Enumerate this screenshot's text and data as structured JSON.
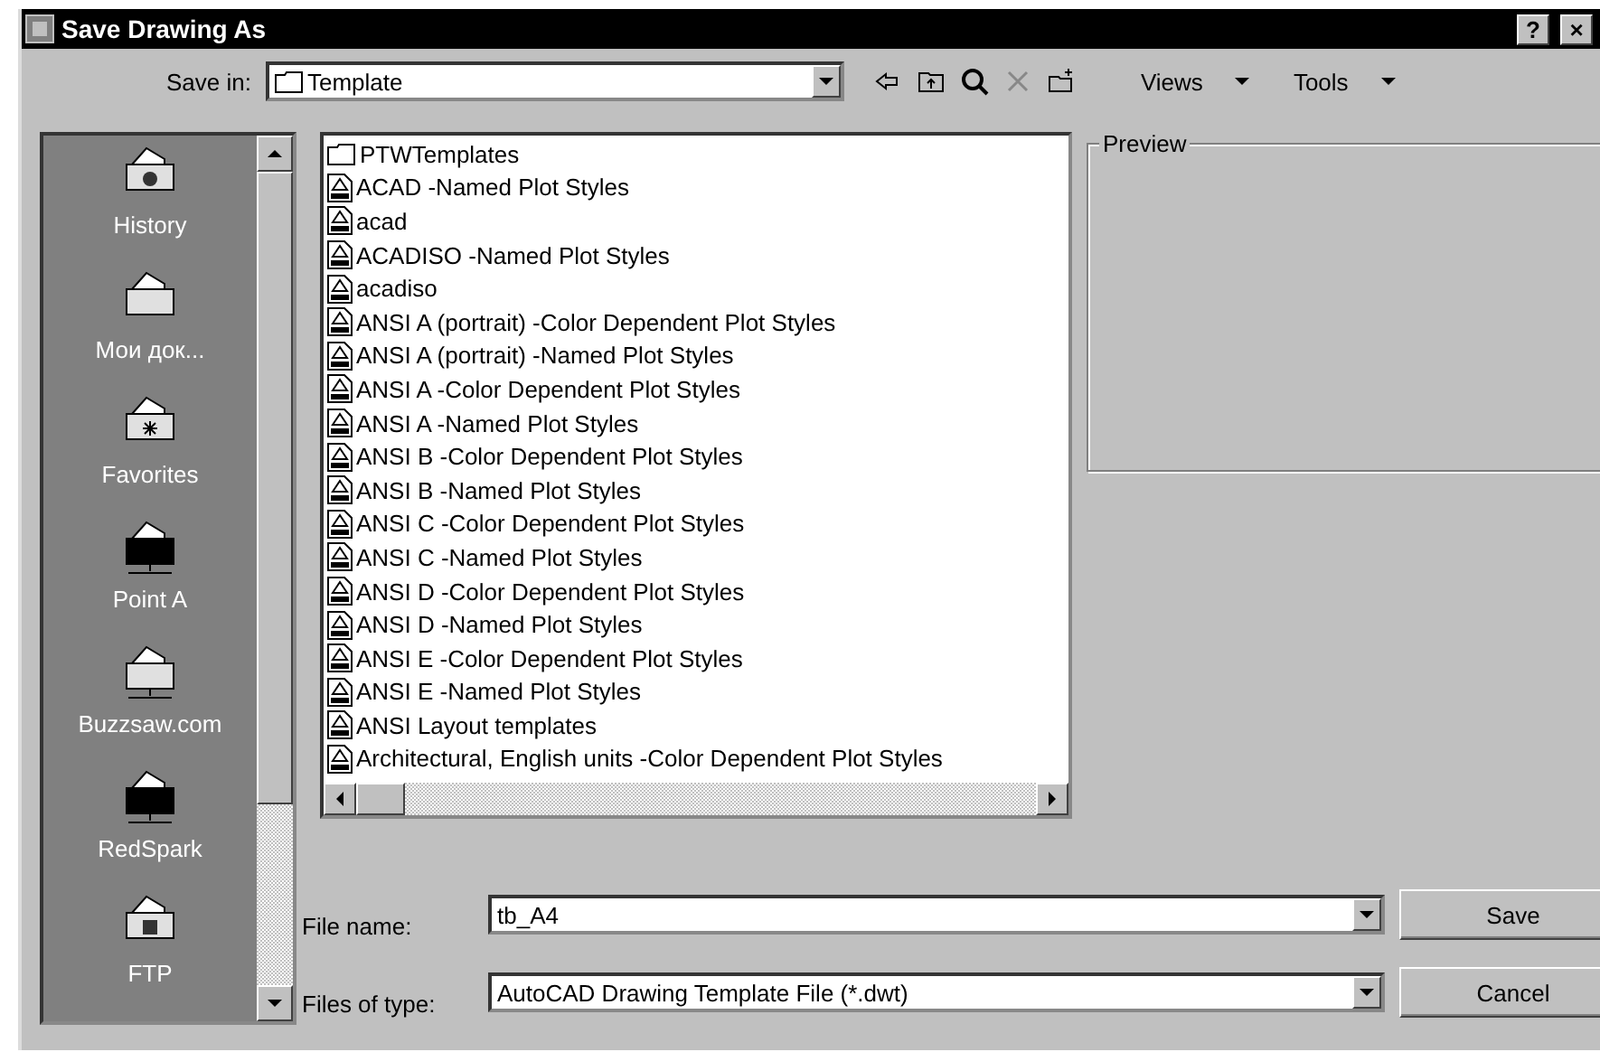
{
  "window": {
    "title": "Save Drawing As",
    "buttons": [
      "?",
      "×"
    ]
  },
  "toolbar": {
    "save_in_label": "Save in:",
    "save_in_value": "Template",
    "views": "Views",
    "tools": "Tools"
  },
  "places": [
    {
      "label": "History",
      "kind": "history"
    },
    {
      "label": "Мои док...",
      "kind": "documents"
    },
    {
      "label": "Favorites",
      "kind": "favorites"
    },
    {
      "label": "Point A",
      "kind": "network-dark"
    },
    {
      "label": "Buzzsaw.com",
      "kind": "network"
    },
    {
      "label": "RedSpark",
      "kind": "network-dark"
    },
    {
      "label": "FTP",
      "kind": "ftp"
    }
  ],
  "files": [
    {
      "name": "PTWTemplates",
      "kind": "folder"
    },
    {
      "name": "ACAD -Named Plot Styles",
      "kind": "template"
    },
    {
      "name": "acad",
      "kind": "template"
    },
    {
      "name": "ACADISO -Named Plot Styles",
      "kind": "template"
    },
    {
      "name": "acadiso",
      "kind": "template"
    },
    {
      "name": "ANSI A (portrait) -Color Dependent Plot Styles",
      "kind": "template"
    },
    {
      "name": "ANSI A (portrait) -Named Plot Styles",
      "kind": "template"
    },
    {
      "name": "ANSI A -Color Dependent Plot Styles",
      "kind": "template"
    },
    {
      "name": "ANSI A -Named Plot Styles",
      "kind": "template"
    },
    {
      "name": "ANSI B -Color Dependent Plot Styles",
      "kind": "template"
    },
    {
      "name": "ANSI B -Named Plot Styles",
      "kind": "template"
    },
    {
      "name": "ANSI C -Color Dependent Plot Styles",
      "kind": "template"
    },
    {
      "name": "ANSI C -Named Plot Styles",
      "kind": "template"
    },
    {
      "name": "ANSI D -Color Dependent Plot Styles",
      "kind": "template"
    },
    {
      "name": "ANSI D -Named Plot Styles",
      "kind": "template"
    },
    {
      "name": "ANSI E -Color Dependent Plot Styles",
      "kind": "template"
    },
    {
      "name": "ANSI E -Named Plot Styles",
      "kind": "template"
    },
    {
      "name": "ANSI Layout templates",
      "kind": "template"
    },
    {
      "name": "Architectural, English units -Color Dependent Plot Styles",
      "kind": "template"
    }
  ],
  "preview": {
    "label": "Preview"
  },
  "file_name": {
    "label": "File name:",
    "value": "tb_A4"
  },
  "file_type": {
    "label": "Files of type:",
    "value": "AutoCAD Drawing Template File (*.dwt)"
  },
  "buttons": [
    "Save",
    "Cancel"
  ]
}
